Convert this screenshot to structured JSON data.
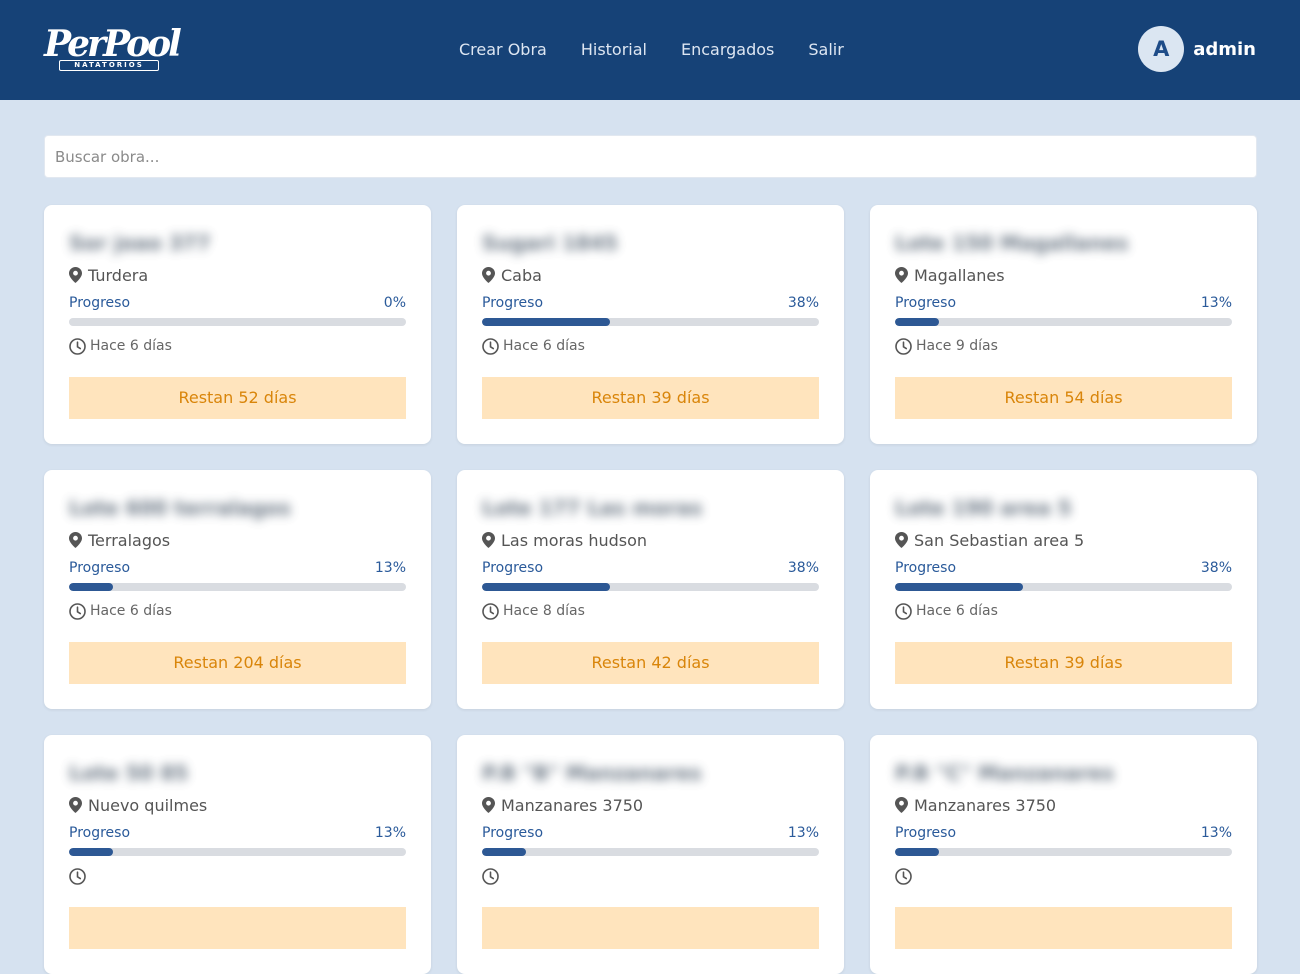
{
  "brand": {
    "name": "PerPool",
    "sub": "NATATORIOS"
  },
  "nav": [
    "Crear Obra",
    "Historial",
    "Encargados",
    "Salir"
  ],
  "user": {
    "initial": "A",
    "name": "admin"
  },
  "search": {
    "placeholder": "Buscar obra...",
    "value": ""
  },
  "progress_label": "Progreso",
  "colors": {
    "header": "#164277",
    "bar_fill": "#2d5894",
    "remain_bg": "#ffe4bd",
    "remain_text": "#d9850a"
  },
  "cards": [
    {
      "title": "Sor joao 377",
      "location": "Turdera",
      "progress": 0,
      "progress_text": "0%",
      "time": "Hace 6 días",
      "remaining": "Restan 52 días"
    },
    {
      "title": "Sugari 1845",
      "location": "Caba",
      "progress": 38,
      "progress_text": "38%",
      "time": "Hace 6 días",
      "remaining": "Restan 39 días"
    },
    {
      "title": "Lote 150 Magallanes",
      "location": "Magallanes",
      "progress": 13,
      "progress_text": "13%",
      "time": "Hace 9 días",
      "remaining": "Restan 54 días"
    },
    {
      "title": "Lote 600 terralagos",
      "location": "Terralagos",
      "progress": 13,
      "progress_text": "13%",
      "time": "Hace 6 días",
      "remaining": "Restan 204 días"
    },
    {
      "title": "Lote 177 Las moras",
      "location": "Las moras hudson",
      "progress": 38,
      "progress_text": "38%",
      "time": "Hace 8 días",
      "remaining": "Restan 42 días"
    },
    {
      "title": "Lote 190 area 5",
      "location": "San Sebastian area 5",
      "progress": 38,
      "progress_text": "38%",
      "time": "Hace 6 días",
      "remaining": "Restan 39 días"
    },
    {
      "title": "Lote 50 85",
      "location": "Nuevo quilmes",
      "progress": 13,
      "progress_text": "13%",
      "time": "",
      "remaining": ""
    },
    {
      "title": "P.B \"B\" Manzanares",
      "location": "Manzanares 3750",
      "progress": 13,
      "progress_text": "13%",
      "time": "",
      "remaining": ""
    },
    {
      "title": "P.B \"C\" Manzanares",
      "location": "Manzanares 3750",
      "progress": 13,
      "progress_text": "13%",
      "time": "",
      "remaining": ""
    }
  ]
}
